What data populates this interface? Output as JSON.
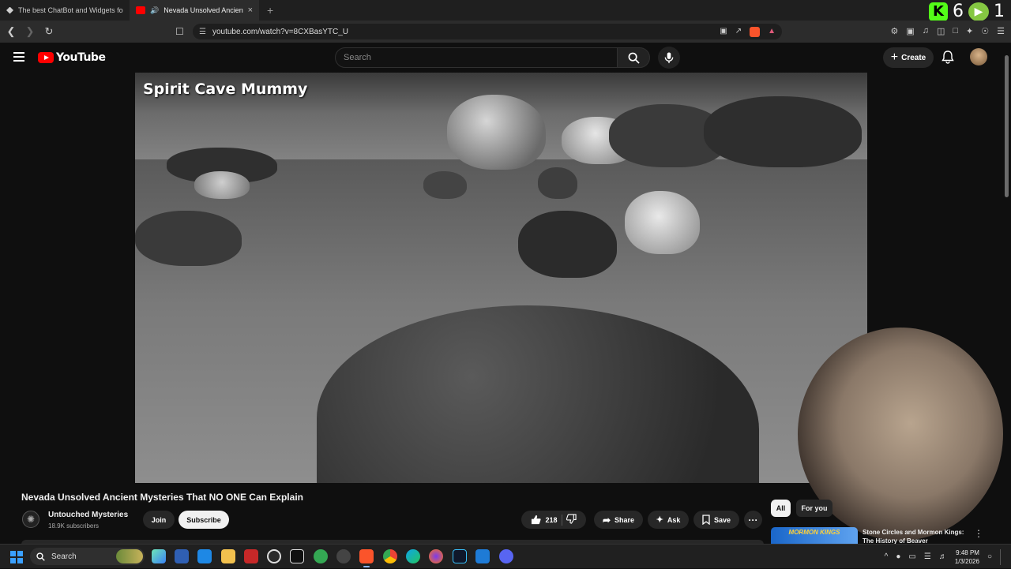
{
  "browser": {
    "tabs": [
      {
        "title": "The best ChatBot and Widgets for Ki",
        "active": false,
        "favicon_color": "#e0e0e0"
      },
      {
        "title": "Nevada Unsolved Ancient My",
        "active": true,
        "favicon_color": "#ff0000"
      }
    ],
    "tab_close": "×",
    "new_tab": "+",
    "url": "youtube.com/watch?v=8CXBasYTC_U",
    "counter_kick": "6",
    "counter_rumble": "1",
    "kick_glyph": "K",
    "rumble_glyph": "▶"
  },
  "youtube": {
    "logo_text": "YouTube",
    "search_placeholder": "Search",
    "create_label": "Create",
    "create_plus": "+"
  },
  "video": {
    "overlay_title": "Spirit Cave Mummy",
    "title": "Nevada Unsolved Ancient Mysteries That NO ONE Can Explain"
  },
  "channel": {
    "avatar_glyph": "✺",
    "name": "Untouched Mysteries",
    "subscribers": "18.9K subscribers",
    "join_label": "Join",
    "subscribe_label": "Subscribe"
  },
  "actions": {
    "likes": "218",
    "share_label": "Share",
    "ask_label": "Ask",
    "save_label": "Save",
    "more_label": "···"
  },
  "sidebar": {
    "chips": [
      "All",
      "For you"
    ],
    "rec_thumb_text": "MORMON KINGS",
    "rec_title": "Stone Circles and Mormon Kings: The History of Beaver",
    "rec_more": "⋮"
  },
  "taskbar": {
    "search_placeholder": "Search",
    "time": "9:48 PM",
    "date": "1/3/2026",
    "tray_chevron": "^"
  }
}
